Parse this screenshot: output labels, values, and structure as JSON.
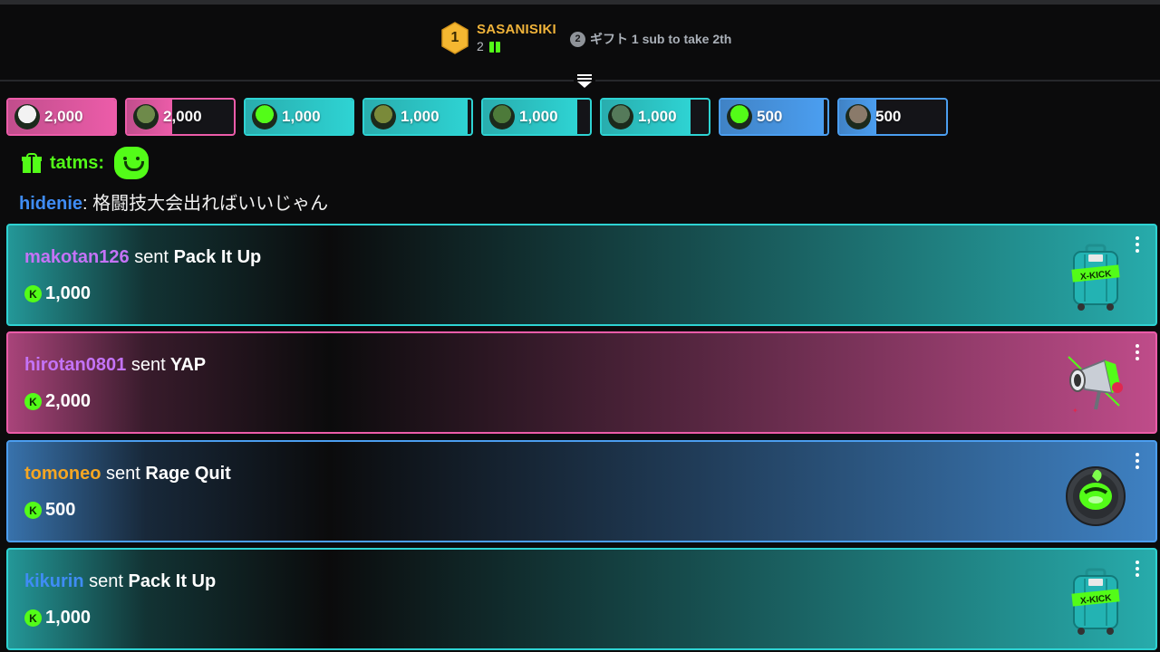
{
  "leaderboard": {
    "rank1": "1",
    "leader_name": "SASANISIKI",
    "leader_count": "2",
    "rank2": "2",
    "take_text": "ギフト 1 sub to take 2th"
  },
  "gift_chips": [
    {
      "amount": "2,000",
      "color": "#ec5ca9",
      "fill": 1.0
    },
    {
      "amount": "2,000",
      "color": "#ec5ca9",
      "fill": 0.42
    },
    {
      "amount": "1,000",
      "color": "#2ed3d3",
      "fill": 1.0
    },
    {
      "amount": "1,000",
      "color": "#2ed3d3",
      "fill": 0.97
    },
    {
      "amount": "1,000",
      "color": "#2ed3d3",
      "fill": 0.88
    },
    {
      "amount": "1,000",
      "color": "#2ed3d3",
      "fill": 0.83
    },
    {
      "amount": "500",
      "color": "#4b9ef0",
      "fill": 0.97
    },
    {
      "amount": "500",
      "color": "#4b9ef0",
      "fill": 0.35
    }
  ],
  "gift_line": {
    "user": "tatms:"
  },
  "chat": {
    "user": "hidenie",
    "separator": ": ",
    "message": "格闘技大会出ればいいじゃん"
  },
  "gift_cards": [
    {
      "user": "makotan126",
      "user_color": "#c473f7",
      "verb": "sent",
      "item": "Pack It Up",
      "amount": "1,000",
      "coin": "K",
      "theme": "#2ed3d3",
      "icon": "pack-it-up-suitcase-icon"
    },
    {
      "user": "hirotan0801",
      "user_color": "#c473f7",
      "verb": "sent",
      "item": "YAP",
      "amount": "2,000",
      "coin": "K",
      "theme": "#ec5ca9",
      "icon": "yap-megaphone-icon"
    },
    {
      "user": "tomoneo",
      "user_color": "#f5a623",
      "verb": "sent",
      "item": "Rage Quit",
      "amount": "500",
      "coin": "K",
      "theme": "#4b9ef0",
      "icon": "rage-quit-button-icon"
    },
    {
      "user": "kikurin",
      "user_color": "#3f8cf5",
      "verb": "sent",
      "item": "Pack It Up",
      "amount": "1,000",
      "coin": "K",
      "theme": "#2ed3d3",
      "icon": "pack-it-up-suitcase-icon"
    }
  ]
}
